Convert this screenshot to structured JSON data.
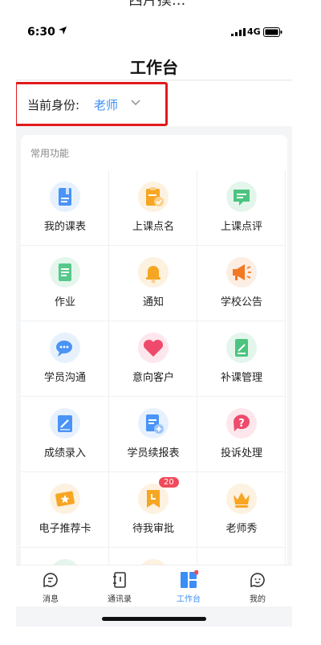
{
  "top_fragment": "西片摸...",
  "status": {
    "time": "6:30",
    "network": "4G"
  },
  "header": {
    "title": "工作台"
  },
  "identity": {
    "label": "当前身份:",
    "value": "老师"
  },
  "section": {
    "title": "常用功能"
  },
  "functions": [
    {
      "label": "我的课表",
      "icon": "schedule-icon"
    },
    {
      "label": "上课点名",
      "icon": "roll-call-icon"
    },
    {
      "label": "上课点评",
      "icon": "comment-icon"
    },
    {
      "label": "作业",
      "icon": "homework-icon"
    },
    {
      "label": "通知",
      "icon": "bell-icon"
    },
    {
      "label": "学校公告",
      "icon": "megaphone-icon"
    },
    {
      "label": "学员沟通",
      "icon": "chat-icon"
    },
    {
      "label": "意向客户",
      "icon": "heart-icon"
    },
    {
      "label": "补课管理",
      "icon": "makeup-class-icon"
    },
    {
      "label": "成绩录入",
      "icon": "edit-icon"
    },
    {
      "label": "学员续报表",
      "icon": "renewal-form-icon"
    },
    {
      "label": "投诉处理",
      "icon": "question-icon"
    },
    {
      "label": "电子推荐卡",
      "icon": "star-card-icon"
    },
    {
      "label": "待我审批",
      "icon": "approval-icon",
      "badge": "20"
    },
    {
      "label": "老师秀",
      "icon": "crown-icon"
    }
  ],
  "tabs": [
    {
      "label": "消息",
      "icon": "message-icon"
    },
    {
      "label": "通讯录",
      "icon": "contacts-icon"
    },
    {
      "label": "工作台",
      "icon": "workbench-icon",
      "active": true
    },
    {
      "label": "我的",
      "icon": "profile-icon"
    }
  ],
  "colors": {
    "accent": "#3a8ef5",
    "highlight": "#e21b1b",
    "badge": "#f04a5b"
  }
}
